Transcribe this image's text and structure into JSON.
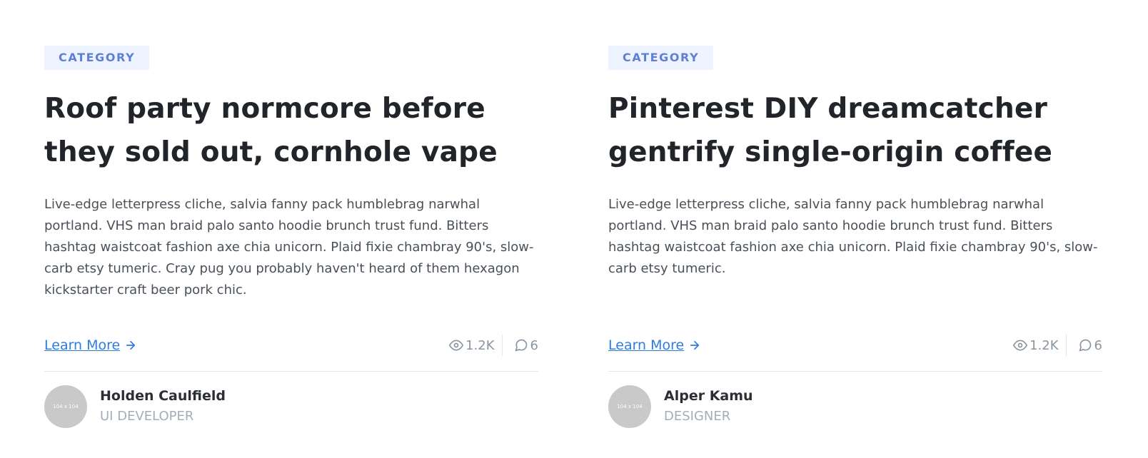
{
  "cards": [
    {
      "category": "CATEGORY",
      "title": "Roof party normcore before they sold out, cornhole vape",
      "description": "Live-edge letterpress cliche, salvia fanny pack humblebrag narwhal portland. VHS man braid palo santo hoodie brunch trust fund. Bitters hashtag waistcoat fashion axe chia unicorn. Plaid fixie chambray 90's, slow-carb etsy tumeric. Cray pug you probably haven't heard of them hexagon kickstarter craft beer pork chic.",
      "learn_more": "Learn More",
      "views": "1.2K",
      "comments": "6",
      "author": {
        "avatar_text": "104 x 104",
        "name": "Holden Caulfield",
        "role": "UI DEVELOPER"
      }
    },
    {
      "category": "CATEGORY",
      "title": "Pinterest DIY dreamcatcher gentrify single-origin coffee",
      "description": "Live-edge letterpress cliche, salvia fanny pack humblebrag narwhal portland. VHS man braid palo santo hoodie brunch trust fund. Bitters hashtag waistcoat fashion axe chia unicorn. Plaid fixie chambray 90's, slow-carb etsy tumeric.",
      "learn_more": "Learn More",
      "views": "1.2K",
      "comments": "6",
      "author": {
        "avatar_text": "104 x 104",
        "name": "Alper Kamu",
        "role": "DESIGNER"
      }
    }
  ],
  "icons": {
    "arrow": "arrow-right-icon",
    "views": "eye-icon",
    "comments": "comment-icon"
  },
  "colors": {
    "accent": "#2f7ce0",
    "category_text": "#5f7fd6",
    "category_bg": "#eef4ff",
    "muted": "#8b95a1"
  }
}
